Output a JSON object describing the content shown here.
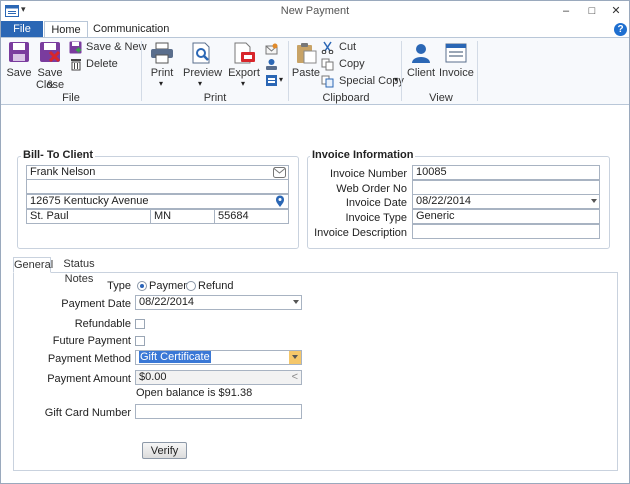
{
  "window": {
    "title": "New Payment",
    "quick_access_icon": "menu-icon",
    "minimize_glyph": "–",
    "maximize_glyph": "□",
    "close_glyph": "✕"
  },
  "ribbon": {
    "tabs": [
      {
        "label": "File"
      },
      {
        "label": "Home"
      },
      {
        "label": "Communication"
      }
    ],
    "help_label": "?",
    "groups": {
      "file": {
        "label": "File",
        "save": "Save",
        "save_close_1": "Save &",
        "save_close_2": "Close",
        "save_new": "Save & New",
        "delete": "Delete"
      },
      "print": {
        "label": "Print",
        "print": "Print",
        "preview": "Preview",
        "export": "Export"
      },
      "clipboard": {
        "label": "Clipboard",
        "paste": "Paste",
        "cut": "Cut",
        "copy": "Copy",
        "special_copy": "Special Copy"
      },
      "view": {
        "label": "View",
        "client": "Client",
        "invoice": "Invoice"
      }
    }
  },
  "bill_to": {
    "title": "Bill- To Client",
    "name": "Frank Nelson",
    "address2": "",
    "street": "12675 Kentucky Avenue",
    "city": "St. Paul",
    "state": "MN",
    "zip": "55684"
  },
  "invoice_info": {
    "title": "Invoice Information",
    "number_label": "Invoice Number",
    "number": "10085",
    "web_order_label": "Web Order No",
    "web_order": "",
    "date_label": "Invoice Date",
    "date": "08/22/2014",
    "type_label": "Invoice Type",
    "type": "Generic",
    "description_label": "Invoice Description",
    "description": ""
  },
  "payment_tabs": [
    {
      "label": "General"
    },
    {
      "label": "Status Notes"
    }
  ],
  "payment": {
    "type_label": "Type",
    "type_options": [
      "Payment",
      "Refund"
    ],
    "type_selected": "Payment",
    "date_label": "Payment Date",
    "date": "08/22/2014",
    "refundable_label": "Refundable",
    "refundable": false,
    "future_label": "Future Payment",
    "future": false,
    "method_label": "Payment Method",
    "method": "Gift Certificate",
    "amount_label": "Payment Amount",
    "amount": "$0.00",
    "amount_btn": "<",
    "balance_text": "Open balance is $91.38",
    "giftcard_label": "Gift Card Number",
    "giftcard": "",
    "verify_label": "Verify"
  },
  "colors": {
    "file_tab": "#2b67b5",
    "accent": "#1e6fd0",
    "highlight": "#3a78d6",
    "dropdown_yellow": "#f5c76a"
  }
}
